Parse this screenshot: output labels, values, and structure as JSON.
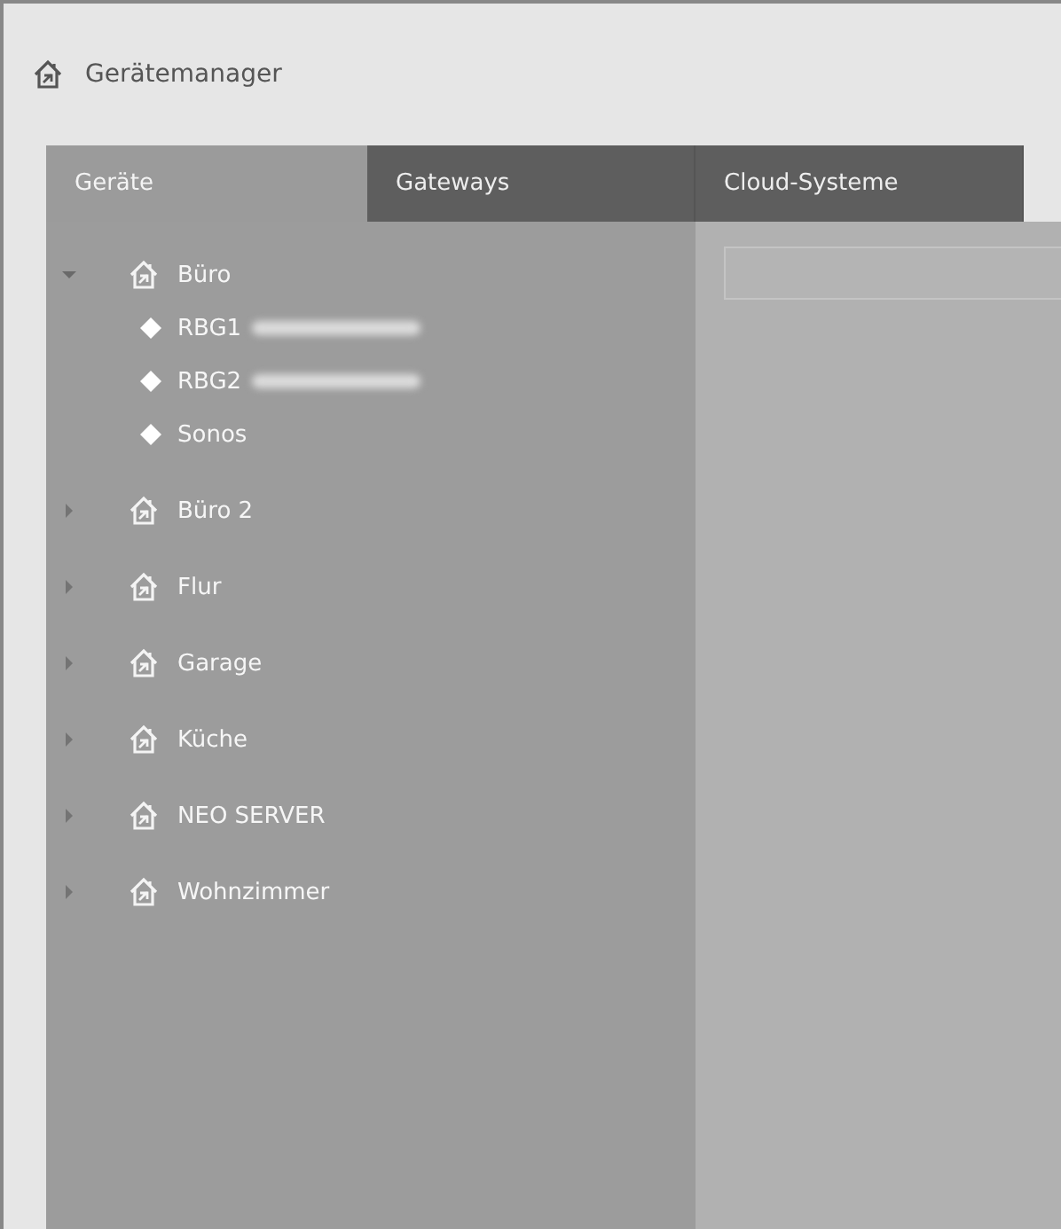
{
  "window": {
    "title": "Gerätemanager"
  },
  "tabs": [
    {
      "label": "Geräte",
      "selected": true
    },
    {
      "label": "Gateways",
      "selected": false
    },
    {
      "label": "Cloud-Systeme",
      "selected": false
    }
  ],
  "tree": [
    {
      "label": "Büro",
      "expanded": true,
      "children": [
        {
          "label": "RBG1",
          "redacted": true
        },
        {
          "label": "RBG2",
          "redacted": true
        },
        {
          "label": "Sonos",
          "redacted": false
        }
      ]
    },
    {
      "label": "Büro 2",
      "expanded": false
    },
    {
      "label": "Flur",
      "expanded": false
    },
    {
      "label": "Garage",
      "expanded": false
    },
    {
      "label": "Küche",
      "expanded": false
    },
    {
      "label": "NEO SERVER",
      "expanded": false
    },
    {
      "label": "Wohnzimmer",
      "expanded": false
    }
  ]
}
